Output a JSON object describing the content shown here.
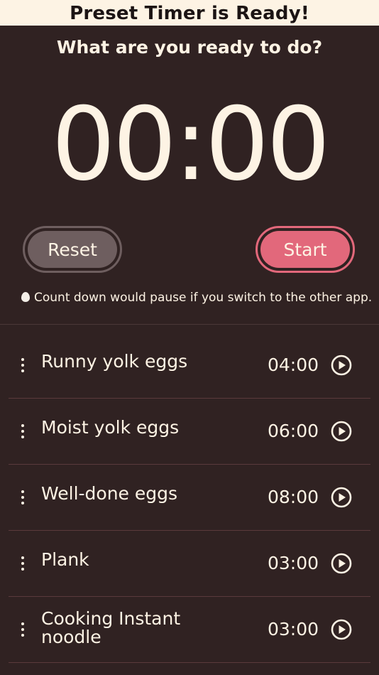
{
  "banner": {
    "title": "Preset Timer is Ready!"
  },
  "main": {
    "question": "What are you ready to do?",
    "timer_display": "00:00",
    "reset_label": "Reset",
    "start_label": "Start",
    "notice": "Count down would pause if you switch to the other app."
  },
  "presets": [
    {
      "label": "Runny yolk eggs",
      "time": "04:00"
    },
    {
      "label": "Moist yolk eggs",
      "time": "06:00"
    },
    {
      "label": "Well-done eggs",
      "time": "08:00"
    },
    {
      "label": "Plank",
      "time": "03:00"
    },
    {
      "label": "Cooking Instant noodle",
      "time": "03:00"
    }
  ],
  "icons": {
    "notice": "egg-icon",
    "row_handle": "drag-handle-icon",
    "row_action": "play-icon"
  },
  "colors": {
    "background": "#302222",
    "text": "#fdf3e4",
    "reset": "#6e5e5f",
    "start": "#e2687b"
  }
}
